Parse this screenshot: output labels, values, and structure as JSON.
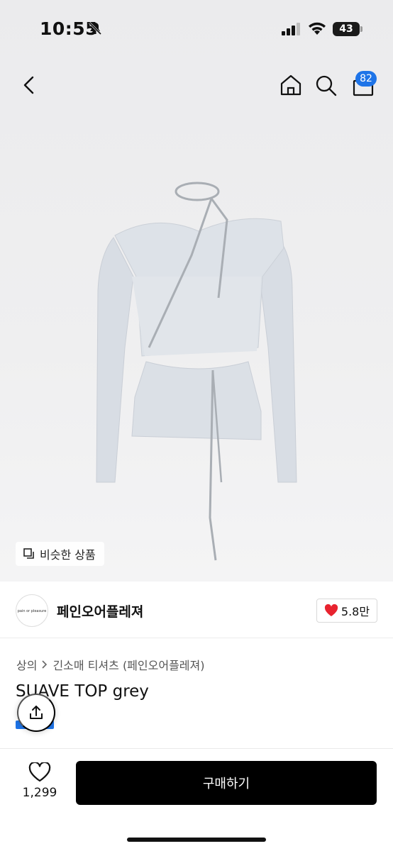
{
  "status_bar": {
    "time": "10:55",
    "battery": "43"
  },
  "header": {
    "cart_count": "82"
  },
  "hero": {
    "similar_label": "비슷한 상품"
  },
  "brand": {
    "logo_text": "pain or pleasure",
    "name": "페인오어플레져",
    "likes": "5.8만"
  },
  "product": {
    "breadcrumb": [
      "상의",
      "긴소매 티셔츠 (페인오어플레져)"
    ],
    "title": "SUAVE TOP grey"
  },
  "bottom": {
    "wish_count": "1,299",
    "buy_label": "구매하기"
  },
  "colors": {
    "accent": "#1e74e8",
    "heart": "#e8232f",
    "buy_bg": "#000000"
  }
}
